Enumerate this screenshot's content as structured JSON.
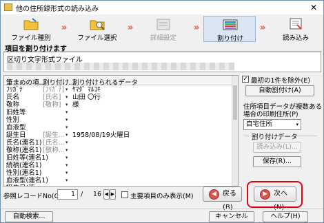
{
  "window": {
    "title": "他の住所録形式の読み込み",
    "close_glyph": "✕"
  },
  "steps": [
    {
      "label": "ファイル種別",
      "icon": "folder-icon",
      "state": "done"
    },
    {
      "label": "ファイル選択",
      "icon": "folder-search-icon",
      "state": "done"
    },
    {
      "label": "詳細設定",
      "icon": "settings-list-icon",
      "state": "disabled"
    },
    {
      "label": "割り付け",
      "icon": "columns-icon",
      "state": "active"
    },
    {
      "label": "読み込み",
      "icon": "import-icon",
      "state": "pending"
    }
  ],
  "arrow_glyph": "»",
  "section_title": "項目を割り付けます",
  "info": {
    "line1": "区切り文字形式ファイル"
  },
  "grid": {
    "headers": [
      "筆まめの項...",
      "割り付け...",
      "割り付けられるデータ"
    ],
    "rows": [
      {
        "field": "ﾌﾘｶﾞﾅ",
        "assign": "[ﾌﾘｶﾞﾅ]",
        "data": "ﾔﾏﾀﾞ ﾏﾙｺｷ"
      },
      {
        "field": "氏名",
        "assign": "[氏名]",
        "data": "山田 〇行"
      },
      {
        "field": "敬称",
        "assign": "[敬称]",
        "data": "様"
      },
      {
        "field": "旧姓等",
        "assign": "",
        "data": ""
      },
      {
        "field": "性別",
        "assign": "",
        "data": ""
      },
      {
        "field": "血液型",
        "assign": "",
        "data": ""
      },
      {
        "field": "誕生日",
        "assign": "[誕生...",
        "data": "1958/08/19火曜日"
      },
      {
        "field": "氏名(連名1)",
        "assign": "[氏名...",
        "data": ""
      },
      {
        "field": "敬称(連名1)",
        "assign": "[敬称...",
        "data": ""
      },
      {
        "field": "旧姓等(連名1)",
        "assign": "",
        "data": ""
      },
      {
        "field": "続柄(連名1)",
        "assign": "",
        "data": ""
      },
      {
        "field": "性別(連名1)",
        "assign": "",
        "data": ""
      },
      {
        "field": "血液型(連名1)",
        "assign": "",
        "data": ""
      },
      {
        "field": "誕生日(連...",
        "assign": "",
        "data": ""
      }
    ],
    "dropdown_glyph": "▾"
  },
  "right_panel": {
    "skip_first_label": "最初の1件を除外(E)",
    "skip_first_checked": true,
    "auto_assign_label": "自動割付け(A)",
    "desc_line1": "住所項目データが複数ある",
    "desc_line2": "場合の印刷住所(P)",
    "address_select": "自宅住所",
    "assign_data_title": "割り付けデータ",
    "load_label": "読み込み(L)...",
    "save_label": "保存(R)..."
  },
  "record": {
    "label": "参照レコードNo(C):",
    "current": "1",
    "separator": "/",
    "total": "16",
    "main_only_label": "主要項目のみ表示(M)",
    "main_only_checked": false
  },
  "nav": {
    "back_label": "戻る(B)",
    "next_label": "次へ(N)"
  },
  "footer": {
    "auto_search": "自動検索...",
    "cancel": "キャンセル",
    "help": "ヘルプ(H)"
  },
  "colors": {
    "highlight": "#e60012",
    "arrow": "#e0553b",
    "nav_circle": "#d9534f"
  }
}
